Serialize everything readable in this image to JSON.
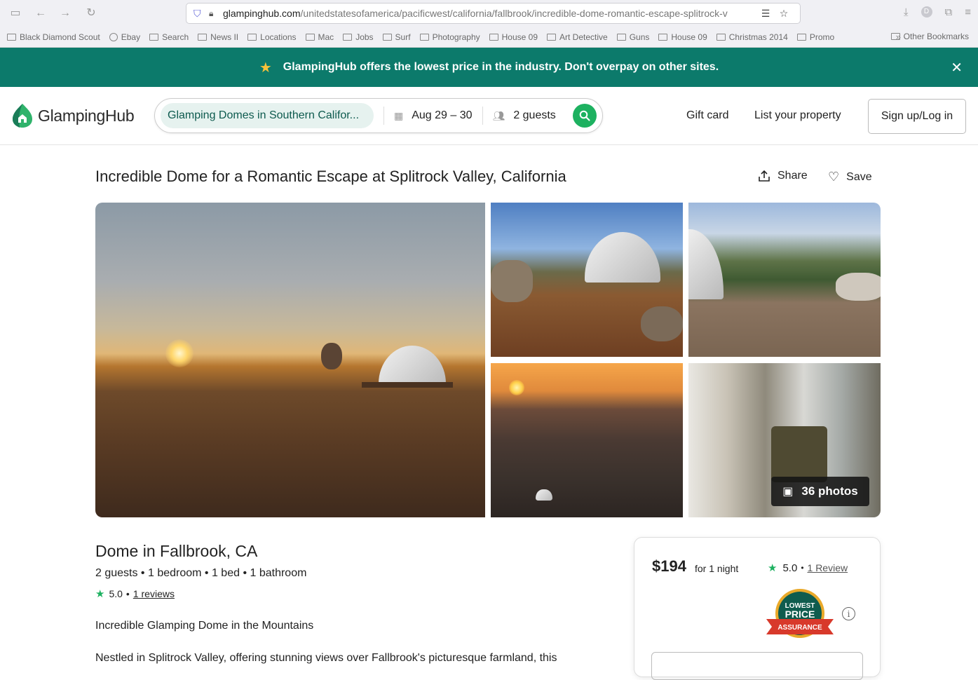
{
  "browser": {
    "url_domain": "glampinghub.com",
    "url_path": "/unitedstatesofamerica/pacificwest/california/fallbrook/incredible-dome-romantic-escape-splitrock-v",
    "bookmarks": [
      "Black Diamond Scout",
      "Ebay",
      "Search",
      "News II",
      "Locations",
      "Mac",
      "Jobs",
      "Surf",
      "Photography",
      "House 09",
      "Art Detective",
      "Guns",
      "House 09",
      "Christmas 2014",
      "Promo"
    ],
    "other_bookmarks": "Other Bookmarks",
    "profile_initial": "D"
  },
  "banner": {
    "text": "GlampingHub offers the lowest price in the industry. Don't overpay on other sites."
  },
  "header": {
    "logo_text": "GlampingHub",
    "search_location": "Glamping Domes in Southern Califor...",
    "search_dates": "Aug 29 – 30",
    "search_guests": "2 guests",
    "gift_card": "Gift card",
    "list_property": "List your property",
    "signup": "Sign up/Log in"
  },
  "listing": {
    "title": "Incredible Dome for a Romantic Escape at Splitrock Valley, California",
    "share": "Share",
    "save": "Save",
    "photos_count": "36 photos",
    "subtitle": "Dome in Fallbrook, CA",
    "specs": "2 guests • 1 bedroom • 1 bed • 1 bathroom",
    "rating": "5.0",
    "reviews_link": "1 reviews",
    "tagline": "Incredible Glamping Dome in the Mountains",
    "description": "Nestled in Splitrock Valley, offering stunning views over Fallbrook's picturesque farmland, this"
  },
  "booking": {
    "price": "$194",
    "per": "for 1 night",
    "rating": "5.0",
    "review_link": "1 Review",
    "badge_top": "LOWEST",
    "badge_mid": "PRICE",
    "badge_ribbon": "ASSURANCE"
  },
  "colors": {
    "brand_teal": "#0c7a6b",
    "accent_green": "#1db160",
    "star_yellow": "#f8c23a"
  }
}
